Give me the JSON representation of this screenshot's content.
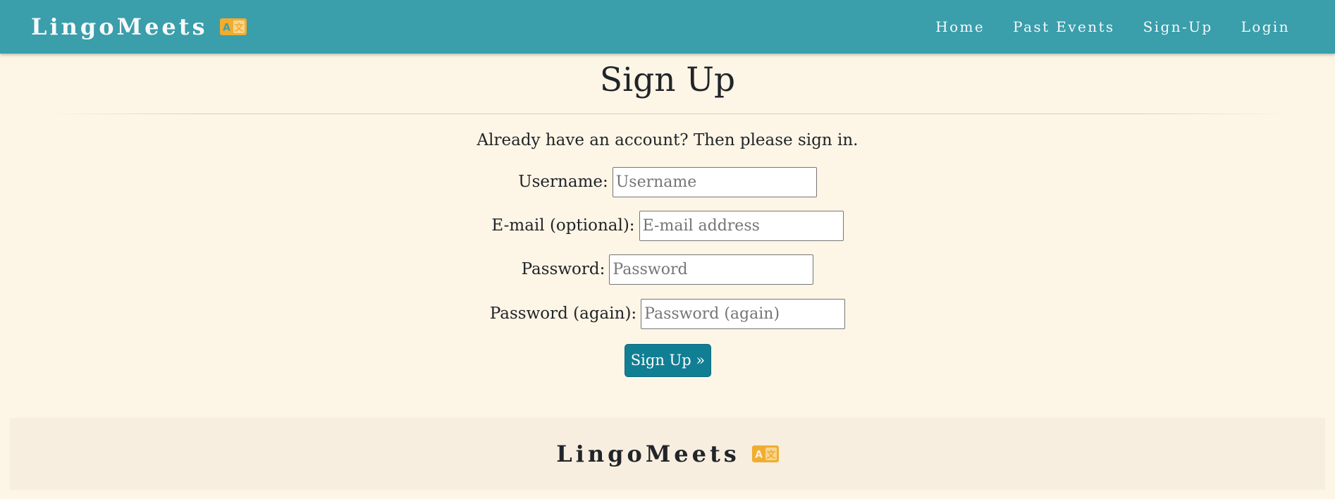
{
  "navbar": {
    "brand": "LingoMeets",
    "brand_icon": "language-icon",
    "links": [
      {
        "label": "Home"
      },
      {
        "label": "Past Events"
      },
      {
        "label": "Sign-Up"
      },
      {
        "label": "Login"
      }
    ],
    "background": "#3a9eab"
  },
  "main": {
    "title": "Sign Up",
    "intro": "Already have an account? Then please sign in.",
    "fields": [
      {
        "label": "Username:",
        "placeholder": "Username",
        "value": ""
      },
      {
        "label": "E-mail (optional):",
        "placeholder": "E-mail address",
        "value": ""
      },
      {
        "label": "Password:",
        "placeholder": "Password",
        "value": ""
      },
      {
        "label": "Password (again):",
        "placeholder": "Password (again)",
        "value": ""
      }
    ],
    "submit_label": "Sign Up »",
    "accent": "#117f93"
  },
  "footer": {
    "brand": "LingoMeets",
    "brand_icon": "language-icon"
  },
  "colors": {
    "page_bg": "#fdf5e6",
    "footer_bg": "#f8eee0",
    "icon": "#f0ad2e"
  }
}
